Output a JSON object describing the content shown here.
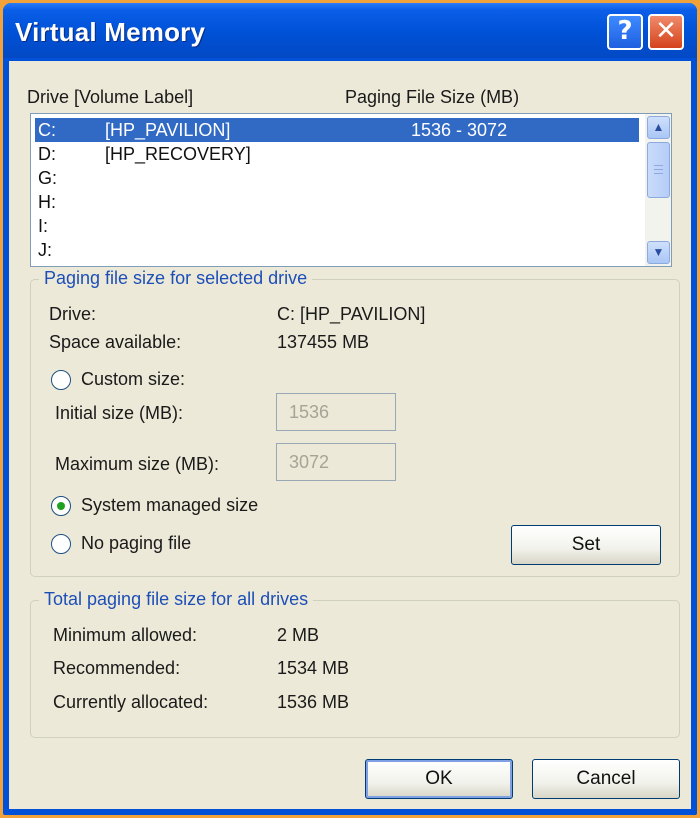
{
  "window": {
    "title": "Virtual Memory",
    "help_glyph": "?",
    "close_glyph": "✕"
  },
  "drive_list": {
    "header_drive": "Drive  [Volume Label]",
    "header_size": "Paging File Size (MB)",
    "rows": [
      {
        "drive": "C:",
        "label": "[HP_PAVILION]",
        "size": "1536 - 3072",
        "selected": true
      },
      {
        "drive": "D:",
        "label": "[HP_RECOVERY]",
        "size": ""
      },
      {
        "drive": "G:",
        "label": "",
        "size": ""
      },
      {
        "drive": "H:",
        "label": "",
        "size": ""
      },
      {
        "drive": "I:",
        "label": "",
        "size": ""
      },
      {
        "drive": "J:",
        "label": "",
        "size": ""
      }
    ]
  },
  "selected_drive": {
    "group_title": "Paging file size for selected drive",
    "drive_label": "Drive:",
    "drive_value": "C:  [HP_PAVILION]",
    "space_label": "Space available:",
    "space_value": "137455 MB",
    "custom_size_label": "Custom size:",
    "initial_label": "Initial size (MB):",
    "initial_value": "1536",
    "max_label": "Maximum size (MB):",
    "max_value": "3072",
    "system_managed_label": "System managed size",
    "no_paging_label": "No paging file",
    "set_button": "Set",
    "selected_option": "system_managed"
  },
  "totals": {
    "group_title": "Total paging file size for all drives",
    "min_label": "Minimum allowed:",
    "min_value": "2 MB",
    "rec_label": "Recommended:",
    "rec_value": "1534 MB",
    "cur_label": "Currently allocated:",
    "cur_value": "1536 MB"
  },
  "buttons": {
    "ok": "OK",
    "cancel": "Cancel"
  },
  "colors": {
    "titlebar": "#0052d8",
    "selection": "#316ac5",
    "group_title": "#1d4fb8",
    "frame_border": "#f2a23a"
  }
}
